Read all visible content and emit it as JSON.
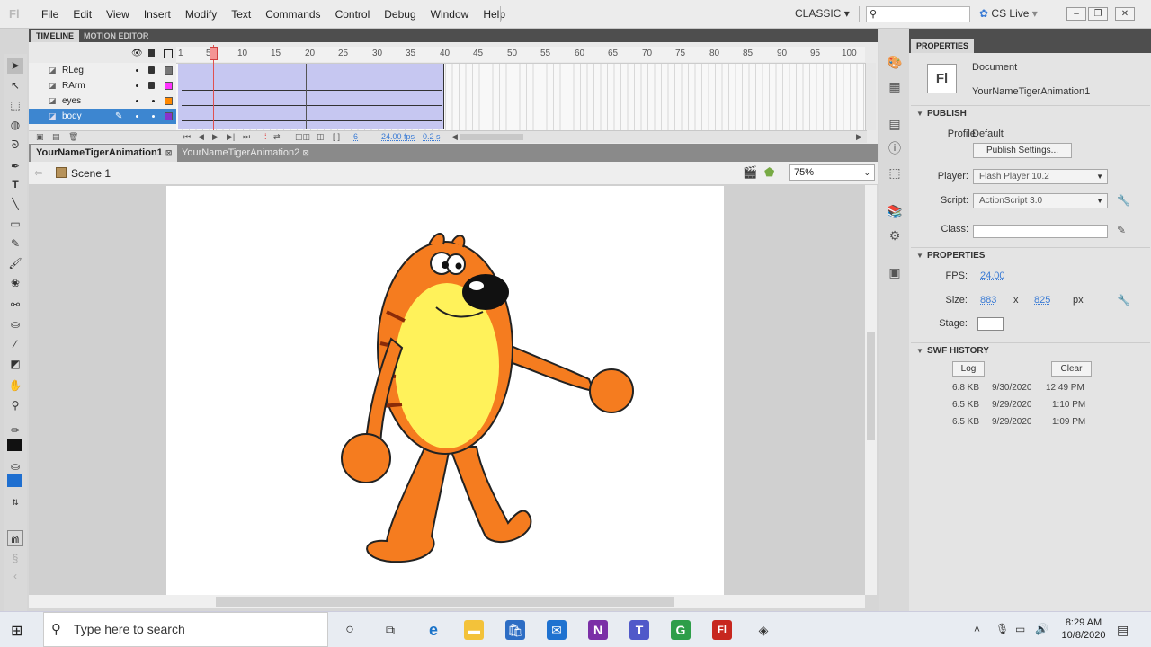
{
  "menubar": {
    "logo": "Fl",
    "items": [
      "File",
      "Edit",
      "View",
      "Insert",
      "Modify",
      "Text",
      "Commands",
      "Control",
      "Debug",
      "Window",
      "Help"
    ],
    "workspace": "CLASSIC",
    "cs_live": "CS Live"
  },
  "timeline": {
    "tabs": [
      "TIMELINE",
      "MOTION EDITOR"
    ],
    "layers": [
      {
        "name": "RLeg",
        "color": "#777777"
      },
      {
        "name": "RArm",
        "color": "#ff33ff"
      },
      {
        "name": "eyes",
        "color": "#ff8800"
      },
      {
        "name": "body",
        "color": "#8833cc"
      }
    ],
    "selected_layer": "body",
    "ruler": [
      "1",
      "5",
      "10",
      "15",
      "20",
      "25",
      "30",
      "35",
      "40",
      "45",
      "50",
      "55",
      "60",
      "65",
      "70",
      "75",
      "80",
      "85",
      "90",
      "95",
      "100"
    ],
    "current_frame": "6",
    "fps": "24.00 fps",
    "time": "0.2 s"
  },
  "documents": {
    "tabs": [
      "YourNameTigerAnimation1",
      "YourNameTigerAnimation2"
    ],
    "scene": "Scene 1",
    "zoom": "75%"
  },
  "properties": {
    "tab": "PROPERTIES",
    "doc_icon": "Fl",
    "doc_type": "Document",
    "doc_name": "YourNameTigerAnimation1",
    "publish_header": "PUBLISH",
    "profile_label": "Profile:",
    "profile_value": "Default",
    "publish_settings": "Publish Settings...",
    "player_label": "Player:",
    "player_value": "Flash Player 10.2",
    "script_label": "Script:",
    "script_value": "ActionScript 3.0",
    "class_label": "Class:",
    "properties_header": "PROPERTIES",
    "fps_label": "FPS:",
    "fps_value": "24.00",
    "size_label": "Size:",
    "width": "883",
    "x_sep": "x",
    "height": "825",
    "unit": "px",
    "stage_label": "Stage:",
    "stage_color": "#ffffff",
    "swf_header": "SWF HISTORY",
    "log_button": "Log",
    "clear_button": "Clear",
    "history": [
      {
        "size": "6.8 KB",
        "date": "9/30/2020",
        "time": "12:49 PM"
      },
      {
        "size": "6.5 KB",
        "date": "9/29/2020",
        "time": "1:10 PM"
      },
      {
        "size": "6.5 KB",
        "date": "9/29/2020",
        "time": "1:09 PM"
      }
    ]
  },
  "taskbar": {
    "search_placeholder": "Type here to search",
    "time": "8:29 AM",
    "date": "10/8/2020"
  },
  "colors": {
    "accent_blue": "#3d86d0",
    "tween": "#c6c7f1",
    "tiger_orange": "#f57c1f",
    "tiger_yellow": "#fff25a"
  }
}
